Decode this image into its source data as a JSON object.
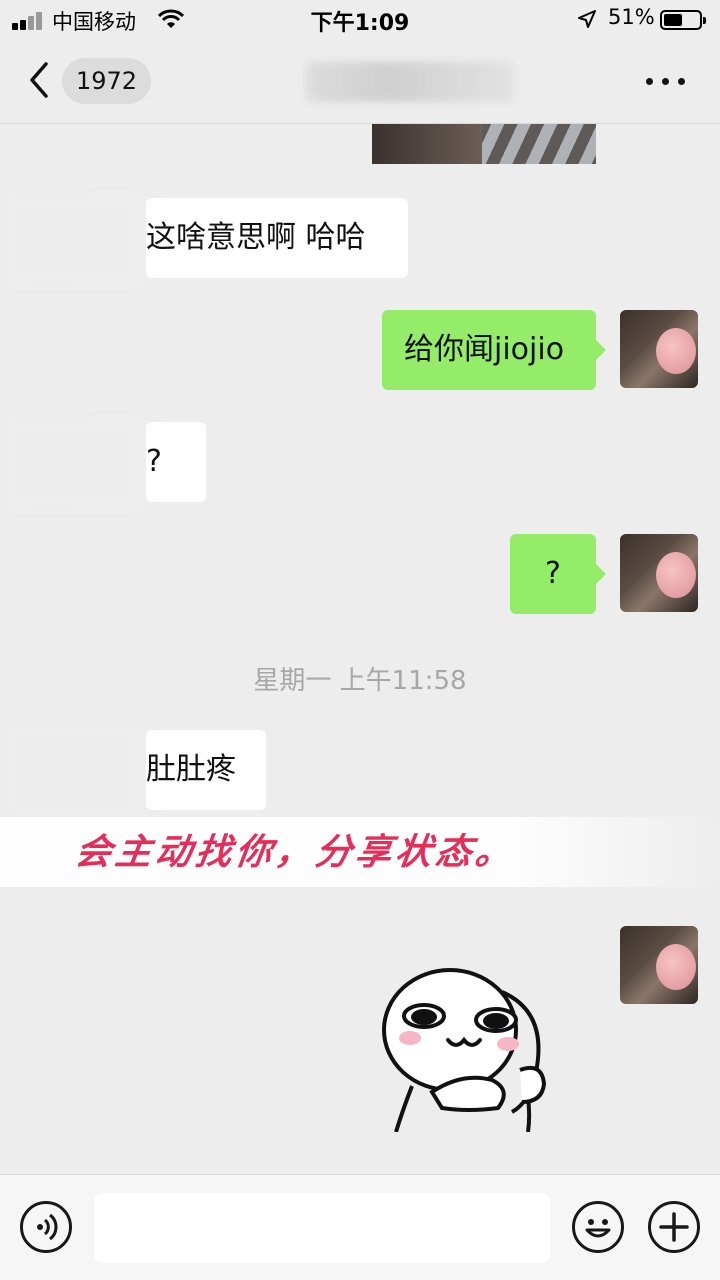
{
  "status_bar": {
    "carrier": "中国移动",
    "time": "下午1:09",
    "battery_percent": "51%",
    "battery_level": 0.51,
    "icons": [
      "signal-icon",
      "wifi-icon",
      "location-arrow-icon",
      "battery-icon"
    ]
  },
  "nav": {
    "back_badge": "1972",
    "icons": [
      "back-chevron-icon",
      "more-dots-icon"
    ]
  },
  "messages": [
    {
      "side": "them",
      "text": "这啥意思啊 哈哈"
    },
    {
      "side": "me",
      "text": "给你闻jiojio"
    },
    {
      "side": "them",
      "text": "?"
    },
    {
      "side": "me",
      "text": "?"
    },
    {
      "side": "them",
      "text": "肚肚疼"
    }
  ],
  "timestamps": [
    "星期一 上午11:58"
  ],
  "overlay_caption": "会主动找你，分享状态。",
  "input_bar": {
    "placeholder": "",
    "icons": [
      "voice-icon",
      "emoji-icon",
      "plus-icon"
    ]
  },
  "colors": {
    "bubble_me": "#95ec69",
    "bubble_them": "#ffffff",
    "background": "#ededed",
    "caption": "#e82c58"
  }
}
